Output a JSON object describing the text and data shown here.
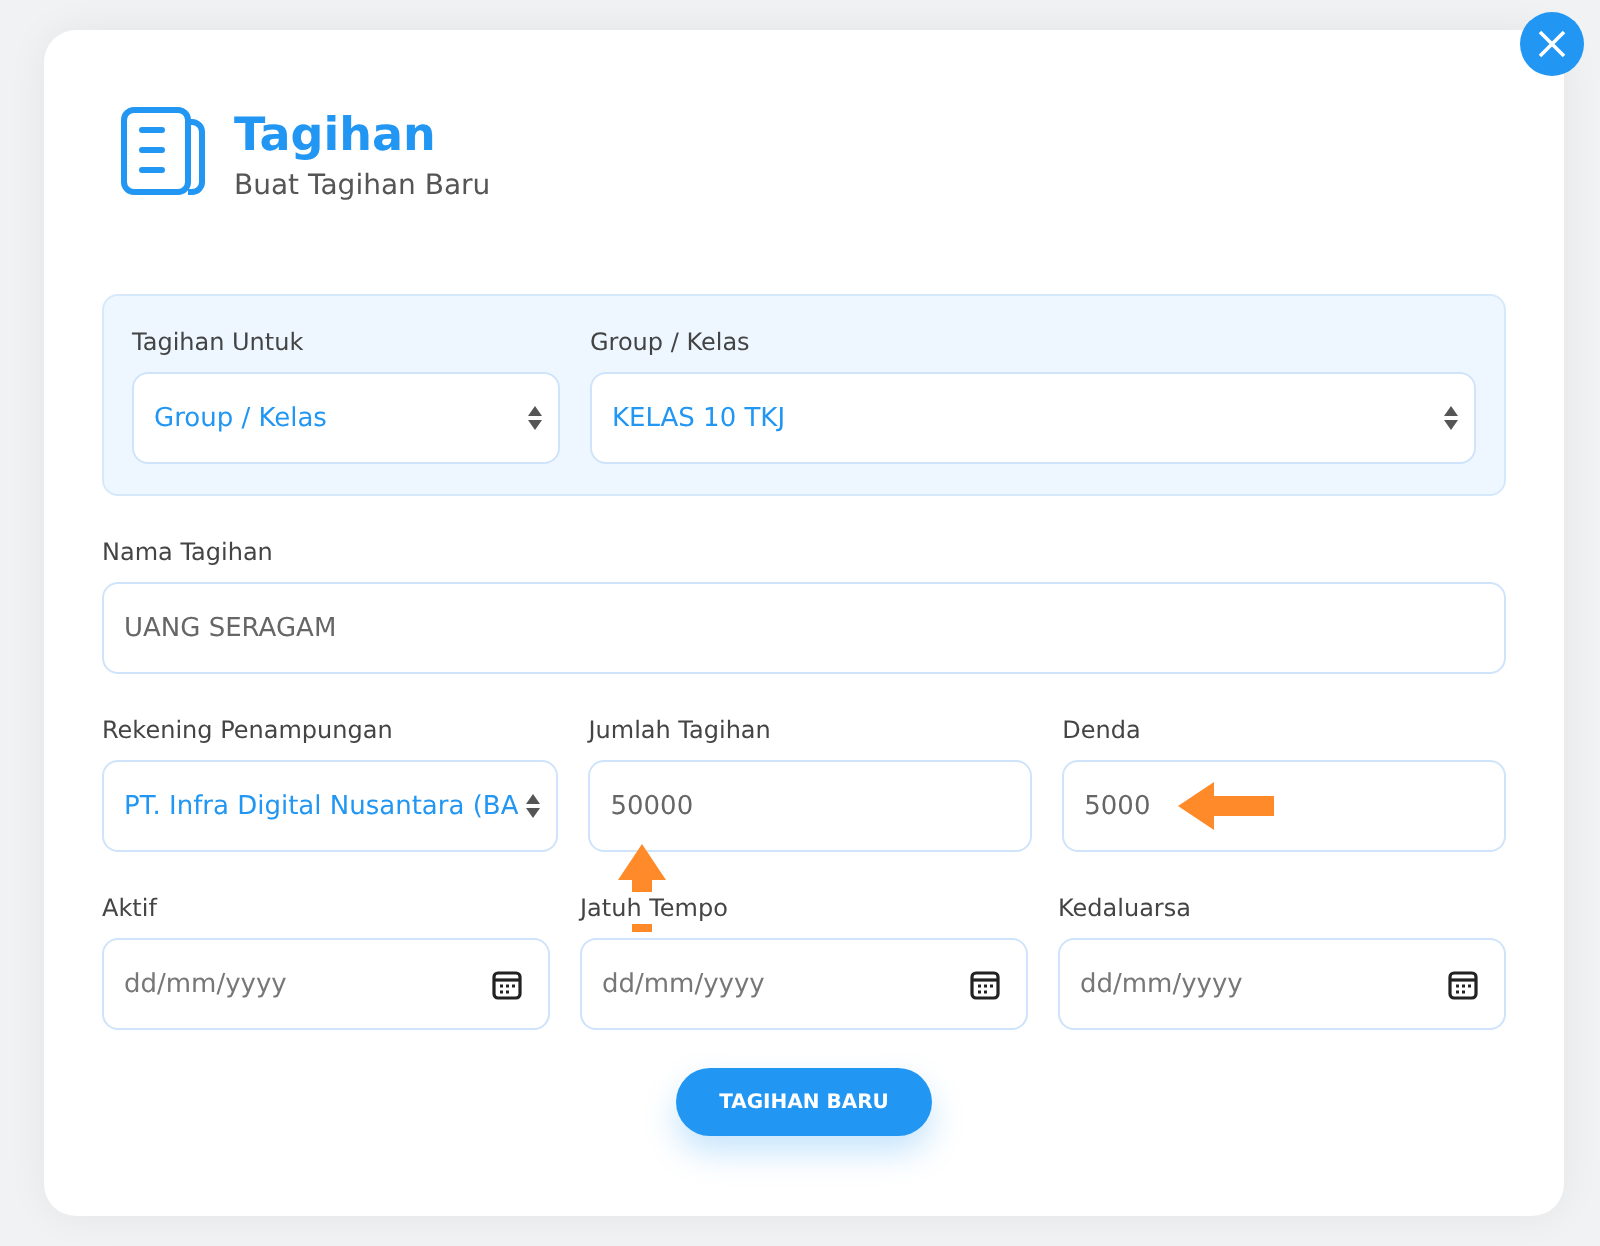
{
  "header": {
    "title": "Tagihan",
    "subtitle": "Buat Tagihan Baru"
  },
  "target_panel": {
    "fields": [
      {
        "label": "Tagihan Untuk",
        "kind": "select",
        "value": "Group / Kelas"
      },
      {
        "label": "Group / Kelas",
        "kind": "select",
        "value": "KELAS 10 TKJ"
      }
    ]
  },
  "rows": [
    {
      "fields": [
        {
          "label": "Nama Tagihan",
          "kind": "text",
          "value": "UANG SERAGAM"
        }
      ]
    },
    {
      "fields": [
        {
          "label": "Rekening Penampungan",
          "kind": "select",
          "value": "PT. Infra Digital Nusantara (BA"
        },
        {
          "label": "Jumlah Tagihan",
          "kind": "text",
          "value": "50000",
          "pointer": {
            "kind": "arrow-up"
          }
        },
        {
          "label": "Denda",
          "kind": "text",
          "value": "5000",
          "pointer": {
            "kind": "arrow-left"
          }
        }
      ]
    },
    {
      "fields": [
        {
          "label": "Aktif",
          "kind": "date",
          "placeholder": "dd/mm/yyyy"
        },
        {
          "label": "Jatuh Tempo",
          "kind": "date",
          "placeholder": "dd/mm/yyyy"
        },
        {
          "label": "Kedaluarsa",
          "kind": "date",
          "placeholder": "dd/mm/yyyy"
        }
      ]
    }
  ],
  "submit_button": "TAGIHAN BARU"
}
